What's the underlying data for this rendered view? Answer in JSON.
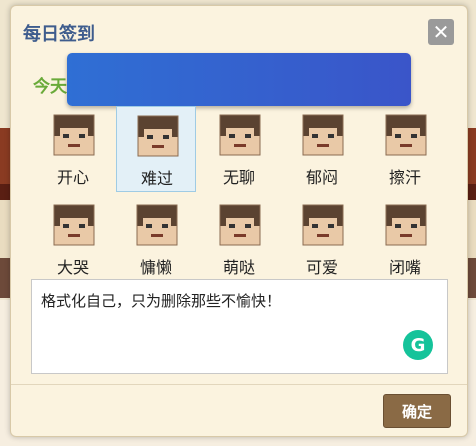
{
  "dialog": {
    "title": "每日签到",
    "today_label": "今天",
    "close_symbol": "✕",
    "confirm_label": "确定",
    "accent_title": "#3e5c8d",
    "accent_today": "#6aaa3a"
  },
  "moods": [
    {
      "label": "开心",
      "icon": "happy-face-icon"
    },
    {
      "label": "难过",
      "icon": "sad-face-icon",
      "selected": true
    },
    {
      "label": "无聊",
      "icon": "bored-face-icon"
    },
    {
      "label": "郁闷",
      "icon": "depressed-face-icon"
    },
    {
      "label": "擦汗",
      "icon": "sweat-face-icon"
    },
    {
      "label": "大哭",
      "icon": "crying-face-icon"
    },
    {
      "label": "慵懒",
      "icon": "lazy-face-icon"
    },
    {
      "label": "萌哒",
      "icon": "cute-face-icon"
    },
    {
      "label": "可爱",
      "icon": "adorable-face-icon"
    },
    {
      "label": "闭嘴",
      "icon": "shut-up-face-icon"
    }
  ],
  "editor": {
    "value": "格式化自己，只为删除那些不愉快！",
    "assistant_icon": "grammarly-icon",
    "assistant_glyph": "G"
  }
}
